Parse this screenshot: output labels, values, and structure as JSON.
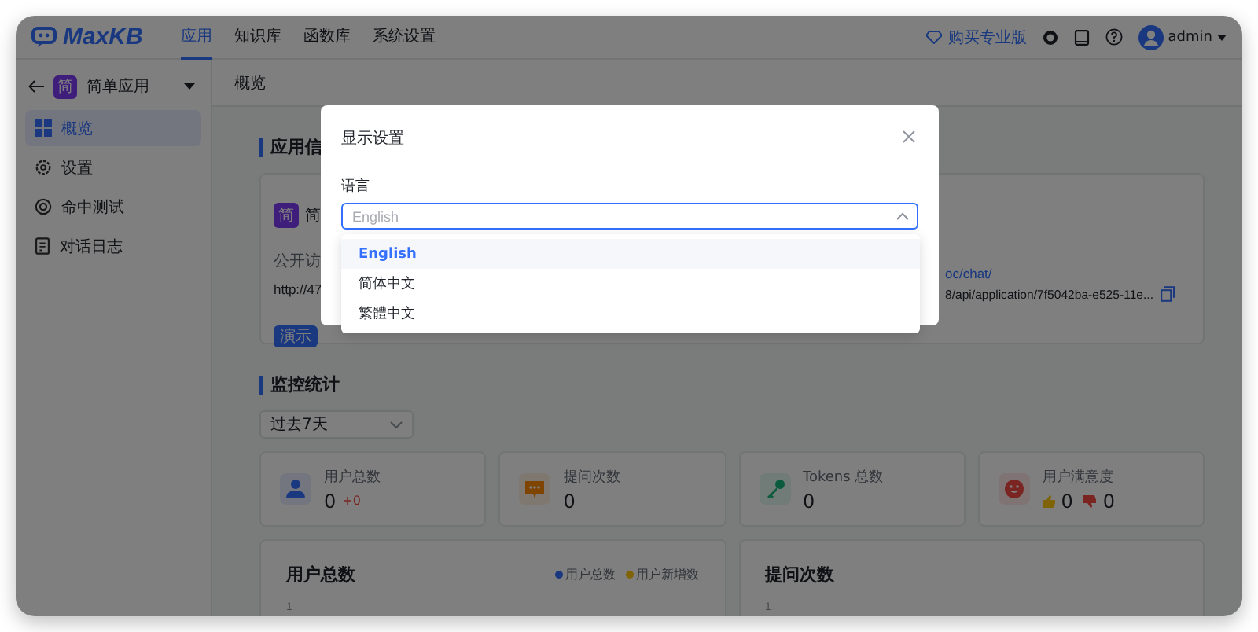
{
  "header": {
    "logo": "MaxKB",
    "nav": [
      {
        "label": "应用",
        "selected": true
      },
      {
        "label": "知识库",
        "selected": false
      },
      {
        "label": "函数库",
        "selected": false
      },
      {
        "label": "系统设置",
        "selected": false
      }
    ],
    "upgrade": "购买专业版",
    "user": "admin"
  },
  "sidebar": {
    "app_avatar": "简",
    "app_name": "简单应用",
    "items": [
      {
        "kind": "overview",
        "label": "概览",
        "selected": true
      },
      {
        "kind": "settings",
        "label": "设置",
        "selected": false
      },
      {
        "kind": "hit-test",
        "label": "命中测试",
        "selected": false
      },
      {
        "kind": "logs",
        "label": "对话日志",
        "selected": false
      }
    ]
  },
  "page_title": "概览",
  "app_info": {
    "heading": "应用信",
    "avatar": "简",
    "name": "简",
    "access_label": "公开访",
    "access_url": "http://47",
    "demo_button": "演示",
    "chat_link": "oc/chat/",
    "api_url": "8/api/application/7f5042ba-e525-11e..."
  },
  "monitor": {
    "heading": "监控统计",
    "range": "过去7天",
    "stats": [
      {
        "kind": "users",
        "label": "用户总数",
        "value": "0",
        "delta": "+0"
      },
      {
        "kind": "questions",
        "label": "提问次数",
        "value": "0"
      },
      {
        "kind": "tokens",
        "label": "Tokens 总数",
        "value": "0"
      },
      {
        "kind": "satisfaction",
        "label": "用户满意度",
        "likes": "0",
        "dislikes": "0"
      }
    ],
    "charts": [
      {
        "title": "用户总数",
        "legend": [
          {
            "label": "用户总数",
            "color": "#1a3880"
          },
          {
            "label": "用户新增数",
            "color": "#806305"
          }
        ],
        "tick": "1"
      },
      {
        "title": "提问次数",
        "tick": "1"
      }
    ]
  },
  "dialog": {
    "title": "显示设置",
    "field_label": "语言",
    "placeholder": "English",
    "expanded": true,
    "options": [
      {
        "label": "English",
        "selected": true
      },
      {
        "label": "简体中文",
        "selected": false
      },
      {
        "label": "繁體中文",
        "selected": false
      }
    ]
  }
}
